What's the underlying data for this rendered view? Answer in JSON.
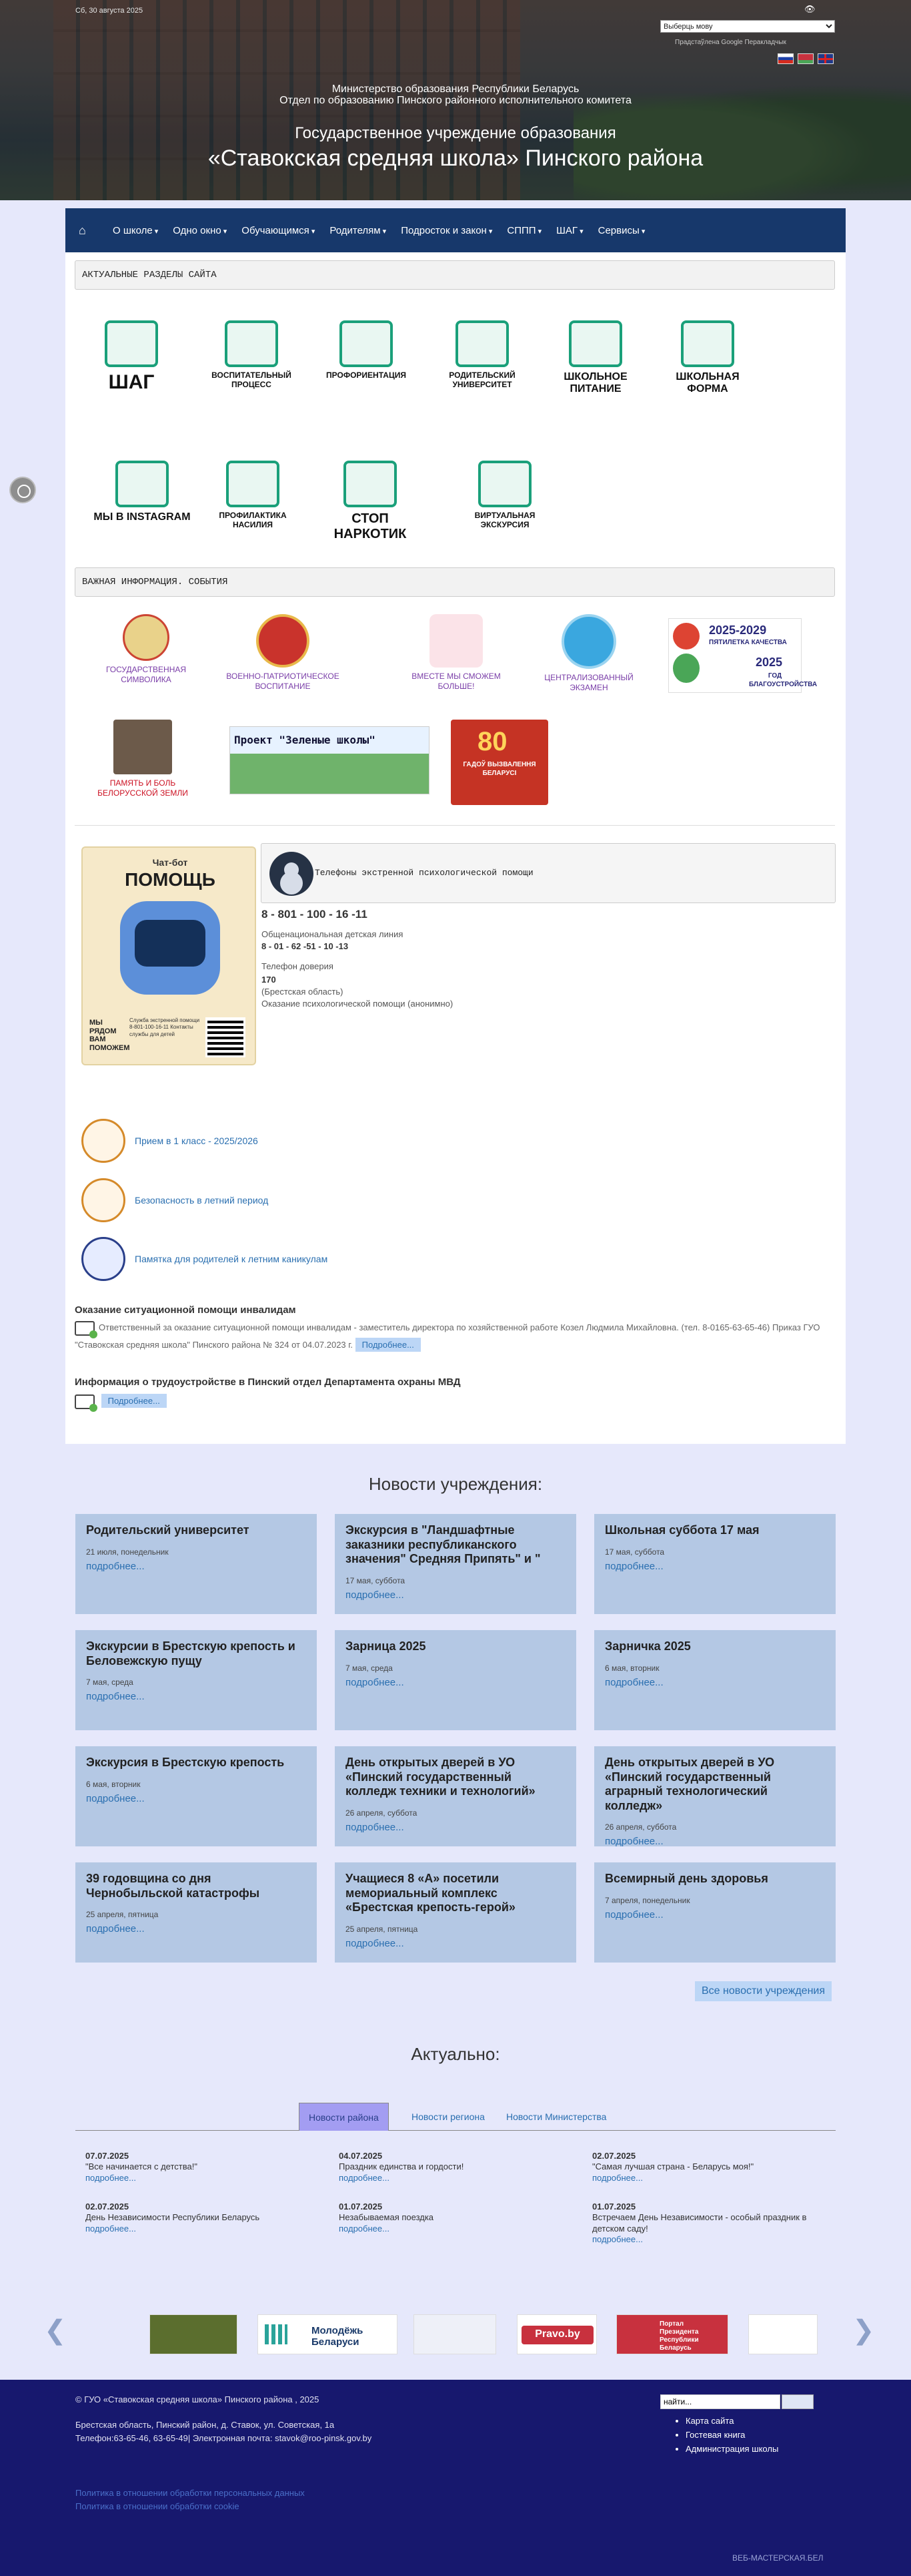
{
  "header": {
    "date": "Сб, 30 августа 2025",
    "language_select": "Выберць мову",
    "powered_by": "Прадстаўлена Google Перакладчык",
    "ministry": "Министерство образования Республики Беларусь",
    "department": "Отдел по образованию Пинского районного исполнительного комитета",
    "institution": "Государственное учреждение образования",
    "school": "«Ставокская средняя школа» Пинского района"
  },
  "nav": {
    "items": [
      "О школе",
      "Одно окно",
      "Обучающимся",
      "Родителям",
      "Подросток и закон",
      "СППП",
      "ШАГ",
      "Сервисы"
    ]
  },
  "sections": {
    "actual": "АКТУАЛЬНЫЕ РАЗДЕЛЫ САЙТА",
    "important": "ВАЖНАЯ ИНФОРМАЦИЯ. СОБЫТИЯ"
  },
  "tiles": [
    "ШАГ",
    "Воспитательный процесс",
    "Профориентация",
    "Родительский университет",
    "Школьное питание",
    "Школьная форма",
    "Мы в Instagram",
    "Профилактика насилия",
    "Стоп наркотик",
    "Виртуальная экскурсия"
  ],
  "banners": [
    "ГОСУДАРСТВЕННАЯ СИМВОЛИКА",
    "ВОЕННО-ПАТРИОТИЧЕСКОЕ ВОСПИТАНИЕ",
    "ВМЕСТЕ МЫ СМОЖЕМ БОЛЬШЕ!",
    "ЦЕНТРАЛИЗОВАННЫЙ ЭКЗАМЕН",
    "ПАМЯТЬ И БОЛЬ БЕЛОРУССКОЙ ЗЕМЛИ"
  ],
  "banner_quality": {
    "years": "2025-2029",
    "line1": "ПЯТИЛЕТКА КАЧЕСТВА",
    "year2": "2025",
    "line2": "ГОД БЛАГОУСТРОЙСТВА"
  },
  "banner_green": "Проект \"Зеленые школы\"",
  "banner_80": {
    "num": "80",
    "text": "ГАДОЎ ВЫЗВАЛЕННЯ БЕЛАРУСІ"
  },
  "robot": {
    "top": "Чат-бот",
    "title": "ПОМОЩЬ",
    "side": "МЫ РЯДОМ ВАМ ПОМОЖЕМ",
    "small": "Служба экстренной помощи 8-801-100-16-11 Контакты службы для детей"
  },
  "phones": {
    "heading": "Телефоны экстренной психологической помощи",
    "main": "8 - 801 - 100 - 16 -11",
    "l1": "Общенациональная детская линия",
    "l2": "8 - 01 - 62 -51 - 10 -13",
    "l3": "Телефон доверия",
    "l4": "170",
    "l5": "(Брестская область)",
    "l6": "Оказание психологической помощи  (анонимно)"
  },
  "links": [
    "Прием в 1 класс - 2025/2026",
    "Безопасность в летний период",
    "Памятка для родителей к летним каникулам"
  ],
  "info": {
    "h1": "Оказание ситуационной помощи инвалидам",
    "t1": "Ответственный за оказание ситуационной помощи инвалидам - заместитель директора по хозяйственной работе Козел Людмила Михайловна. (тел. 8-0165-63-65-46) Приказ ГУО \"Ставокская средняя школа\" Пинского района № 324 от 04.07.2023 г.",
    "h2": "Информация о трудоустройстве в Пинский отдел Департамента охраны МВД",
    "more": "Подробнее..."
  },
  "news_title": "Новости учреждения:",
  "news": [
    {
      "title": "Родительский университет",
      "date": "21 июля, понедельник"
    },
    {
      "title": "Экскурсия в \"Ландшафтные заказники республиканского значения\" Средняя Припять\" и \"",
      "date": "17 мая, суббота"
    },
    {
      "title": "Школьная суббота 17 мая",
      "date": "17 мая, суббота"
    },
    {
      "title": "Экскурсии в Брестскую крепость и Беловежскую пущу",
      "date": "7 мая, среда"
    },
    {
      "title": "Зарница 2025",
      "date": "7 мая, среда"
    },
    {
      "title": "Зарничка 2025",
      "date": "6 мая, вторник"
    },
    {
      "title": "Экскурсия в Брестскую крепость",
      "date": "6 мая, вторник"
    },
    {
      "title": "День открытых дверей в УО «Пинский государственный колледж техники и технологий»",
      "date": "26 апреля, суббота"
    },
    {
      "title": "День открытых дверей в УО «Пинский государственный аграрный технологический колледж»",
      "date": "26 апреля, суббота"
    },
    {
      "title": "39 годовщина со дня Чернобыльской катастрофы",
      "date": "25 апреля, пятница"
    },
    {
      "title": "Учащиеся 8 «А» посетили мемориальный комплекс «Брестская крепость-герой»",
      "date": "25 апреля, пятница"
    },
    {
      "title": "Всемирный день здоровья",
      "date": "7 апреля, понедельник"
    }
  ],
  "news_more": "подробнее...",
  "all_news": "Все новости учреждения",
  "actual_title": "Актуально:",
  "tabs": [
    "Новости района",
    "Новости региона",
    "Новости Министерства"
  ],
  "actual": [
    {
      "date": "07.07.2025",
      "text": "\"Все начинается с детства!\""
    },
    {
      "date": "04.07.2025",
      "text": "Праздник единства и гордости!"
    },
    {
      "date": "02.07.2025",
      "text": "\"Самая лучшая страна - Беларусь моя!\""
    },
    {
      "date": "02.07.2025",
      "text": "День Независимости Республики Беларусь"
    },
    {
      "date": "01.07.2025",
      "text": "Незабываемая поездка"
    },
    {
      "date": "01.07.2025",
      "text": "Встречаем День Независимости - особый праздник в детском саду!"
    }
  ],
  "partners": [
    "Молодёжь Беларуси",
    "Pravo.by",
    "Портал Президента Республики Беларусь"
  ],
  "footer": {
    "copy": "© ГУО «Ставокская средняя школа» Пинского района , 2025",
    "address": "Брестская область, Пинский район, д. Ставок, ул. Советская, 1а",
    "phone": "Телефон:63-65-46, 63-65-49| Электронная почта: stavok@roo-pinsk.gov.by",
    "search_value": "найти...",
    "menu": [
      "Карта сайта",
      "Гостевая книга",
      "Администрация школы"
    ],
    "policy1": "Политика в отношении обработки персональных данных",
    "policy2": "Политика в отношении обработки cookie",
    "watermark": "ВЕБ-МАСТЕРСКАЯ.БЕЛ"
  }
}
